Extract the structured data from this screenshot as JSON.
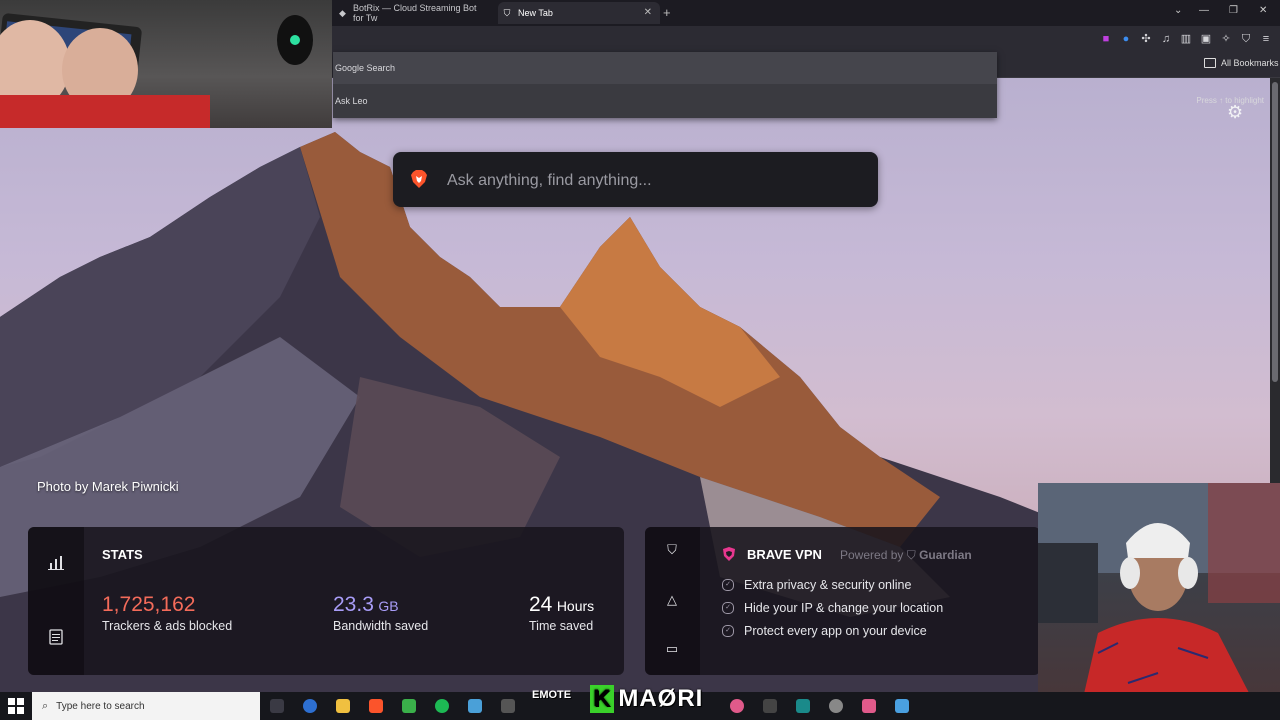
{
  "browser": {
    "tabs": [
      {
        "title": "BotRix — Cloud Streaming Bot for Tw",
        "active": false
      },
      {
        "title": "New Tab",
        "active": true
      }
    ],
    "bookmarks_label": "All Bookmarks"
  },
  "omnibox_dropdown": {
    "items": [
      "Google Search",
      "Ask Leo"
    ],
    "hint": "Press ↑ to highlight"
  },
  "new_tab": {
    "search_placeholder": "Ask anything, find anything...",
    "photo_credit": "Photo by Marek Piwnicki"
  },
  "stats": {
    "title": "STATS",
    "items": [
      {
        "value": "1,725,162",
        "unit": "",
        "label": "Trackers & ads blocked",
        "color": "#f46b5a"
      },
      {
        "value": "23.3",
        "unit": "GB",
        "label": "Bandwidth saved",
        "color": "#a89cf7"
      },
      {
        "value": "24",
        "unit": "Hours",
        "label": "Time saved",
        "color": "#ffffff"
      }
    ]
  },
  "vpn": {
    "title": "BRAVE VPN",
    "powered_by": "Powered by",
    "partner": "Guardian",
    "features": [
      "Extra privacy & security online",
      "Hide your IP & change your location",
      "Protect every app on your device"
    ]
  },
  "taskbar": {
    "search_text": "Type here to search",
    "overlay_text": "MAØRI",
    "overlay_badge": "K",
    "emote_text": "EMOTE"
  },
  "colors": {
    "brave_orange": "#fb542b",
    "vpn_pink": "#e8378f",
    "chrome_dark": "#2c2b33"
  }
}
